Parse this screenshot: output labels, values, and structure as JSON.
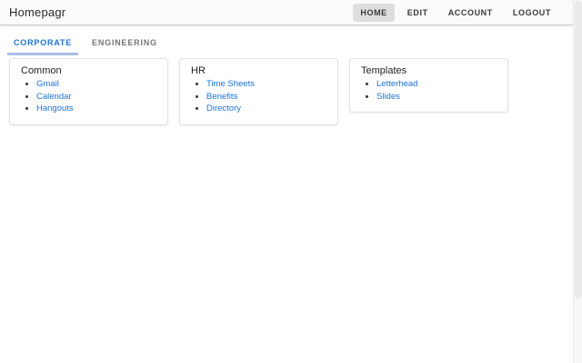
{
  "app": {
    "brand": "Homepagr"
  },
  "nav": {
    "items": [
      {
        "label": "HOME",
        "active": true
      },
      {
        "label": "EDIT",
        "active": false
      },
      {
        "label": "ACCOUNT",
        "active": false
      },
      {
        "label": "LOGOUT",
        "active": false
      }
    ]
  },
  "tabs": [
    {
      "label": "CORPORATE",
      "active": true
    },
    {
      "label": "ENGINEERING",
      "active": false
    }
  ],
  "groups": [
    {
      "title": "Common",
      "links": [
        {
          "label": "Gmail"
        },
        {
          "label": "Calendar"
        },
        {
          "label": "Hangouts"
        }
      ]
    },
    {
      "title": "HR",
      "links": [
        {
          "label": "Time Sheets"
        },
        {
          "label": "Benefits"
        },
        {
          "label": "Directory"
        }
      ]
    },
    {
      "title": "Templates",
      "links": [
        {
          "label": "Letterhead"
        },
        {
          "label": "Slides"
        }
      ]
    }
  ],
  "colors": {
    "accent_blue": "#1a73e8",
    "tab_underline": "#a9bfe8",
    "inactive_tab_gray": "#757575",
    "active_nav_bg": "#dedede"
  }
}
